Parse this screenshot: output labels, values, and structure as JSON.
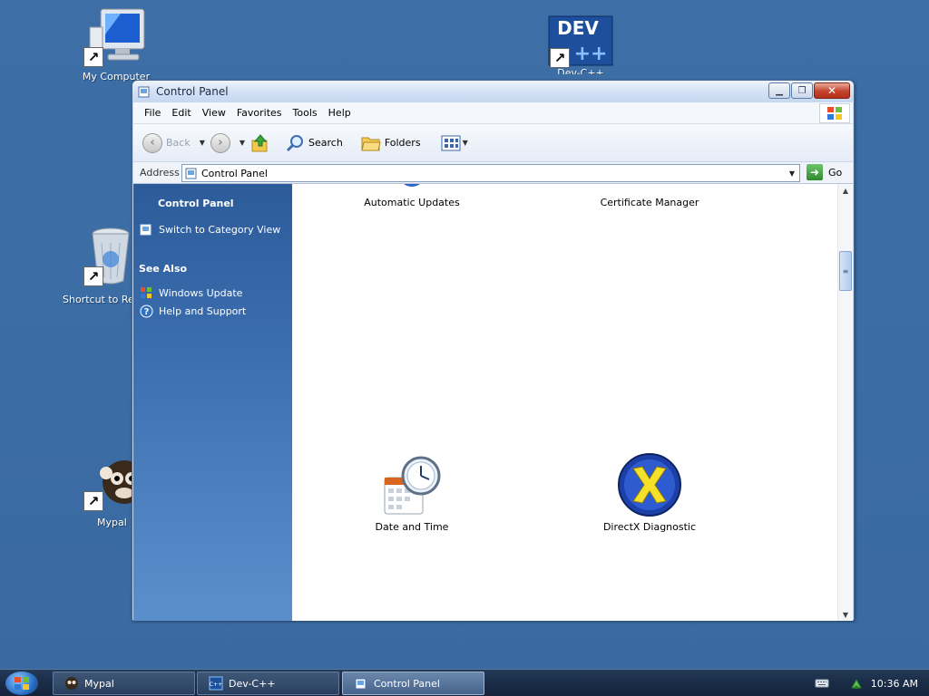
{
  "desktop": {
    "icons": [
      {
        "label": "My Computer"
      },
      {
        "label": "Dev-C++"
      },
      {
        "label": "Shortcut to Re"
      },
      {
        "label": "Mypal"
      }
    ],
    "dev_logo_text": "DEV"
  },
  "window": {
    "title": "Control Panel",
    "menu": [
      "File",
      "Edit",
      "View",
      "Favorites",
      "Tools",
      "Help"
    ],
    "toolbar": {
      "back_label": "Back",
      "search_label": "Search",
      "folders_label": "Folders"
    },
    "address": {
      "label": "Address",
      "value": "Control Panel",
      "go_label": "Go"
    },
    "sidepanel": {
      "heading": "Control Panel",
      "switch_view": "Switch to Category View",
      "see_also": "See Also",
      "links": [
        "Windows Update",
        "Help and Support"
      ]
    },
    "items": [
      {
        "label": "Automatic Updates"
      },
      {
        "label": "Certificate Manager"
      },
      {
        "label": "Date and Time"
      },
      {
        "label": "DirectX Diagnostic"
      }
    ]
  },
  "taskbar": {
    "tasks": [
      {
        "label": "Mypal"
      },
      {
        "label": "Dev-C++"
      },
      {
        "label": "Control Panel"
      }
    ],
    "clock": "10:36 AM"
  },
  "colors": {
    "desktop": "#3a6ea5",
    "sidepanel": "#2d5b9a",
    "accent_green": "#2e8b2b"
  }
}
